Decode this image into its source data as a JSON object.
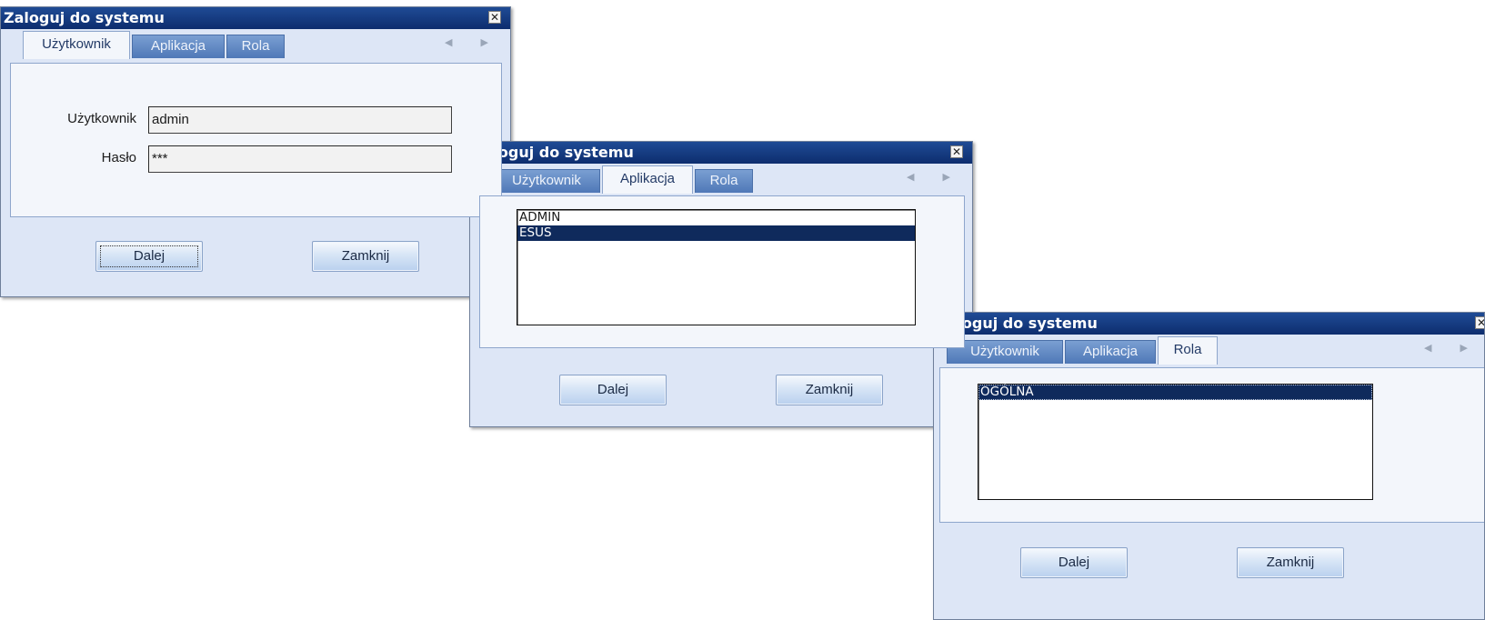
{
  "dialogs": [
    {
      "title": "Zaloguj do systemu",
      "close_glyph": "✕",
      "tabs": [
        "Użytkownik",
        "Aplikacja",
        "Rola"
      ],
      "active_tab": "Użytkownik",
      "fields": {
        "user_label": "Użytkownik",
        "user_value": "admin",
        "password_label": "Hasło",
        "password_value": "***"
      },
      "buttons": {
        "next": "Dalej",
        "close": "Zamknij"
      }
    },
    {
      "title": "Zaloguj do systemu",
      "close_glyph": "✕",
      "tabs": [
        "Użytkownik",
        "Aplikacja",
        "Rola"
      ],
      "active_tab": "Aplikacja",
      "list_items": [
        "ADMIN",
        "ESUS"
      ],
      "selected_item": "ESUS",
      "buttons": {
        "next": "Dalej",
        "close": "Zamknij"
      }
    },
    {
      "title": "Zaloguj do systemu",
      "close_glyph": "✕",
      "tabs": [
        "Użytkownik",
        "Aplikacja",
        "Rola"
      ],
      "active_tab": "Rola",
      "list_items": [
        "OGÓLNA"
      ],
      "selected_item": "OGÓLNA",
      "buttons": {
        "next": "Dalej",
        "close": "Zamknij"
      }
    }
  ],
  "tab_scroll_arrows": "◀ ▶",
  "colors": {
    "titlebar": "#1f4b95",
    "dialog_bg": "#dde6f6",
    "tab_inactive": "#5f86c2",
    "selection": "#0f2a5c"
  }
}
